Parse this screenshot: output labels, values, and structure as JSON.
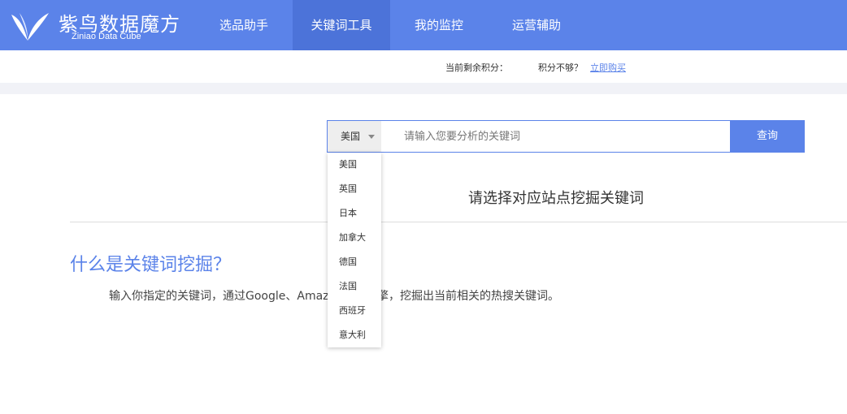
{
  "brand": {
    "title": "紫鸟数据魔方",
    "subtitle": "Ziniao Data Cube"
  },
  "nav": {
    "items": [
      {
        "label": "选品助手"
      },
      {
        "label": "关键词工具"
      },
      {
        "label": "我的监控"
      },
      {
        "label": "运营辅助"
      }
    ],
    "active_index": 1
  },
  "points": {
    "label": "当前剩余积分：",
    "lack": "积分不够？",
    "buy_link": "立即购买"
  },
  "search": {
    "selected_country": "美国",
    "placeholder": "请输入您要分析的关键词",
    "value": "",
    "button": "查询"
  },
  "dropdown": {
    "options": [
      "美国",
      "英国",
      "日本",
      "加拿大",
      "德国",
      "法国",
      "西班牙",
      "意大利"
    ]
  },
  "prompt": "请选择对应站点挖掘关键词",
  "info": {
    "title": "什么是关键词挖掘？",
    "desc": "输入你指定的关键词，通过Google、Amazon搜索引擎，挖掘出当前相关的热搜关键词。"
  },
  "colors": {
    "brand": "#5b83e9",
    "nav_active": "#4c73d9"
  },
  "icons": {
    "logo": "bird-logo-icon",
    "caret": "caret-down-icon"
  }
}
